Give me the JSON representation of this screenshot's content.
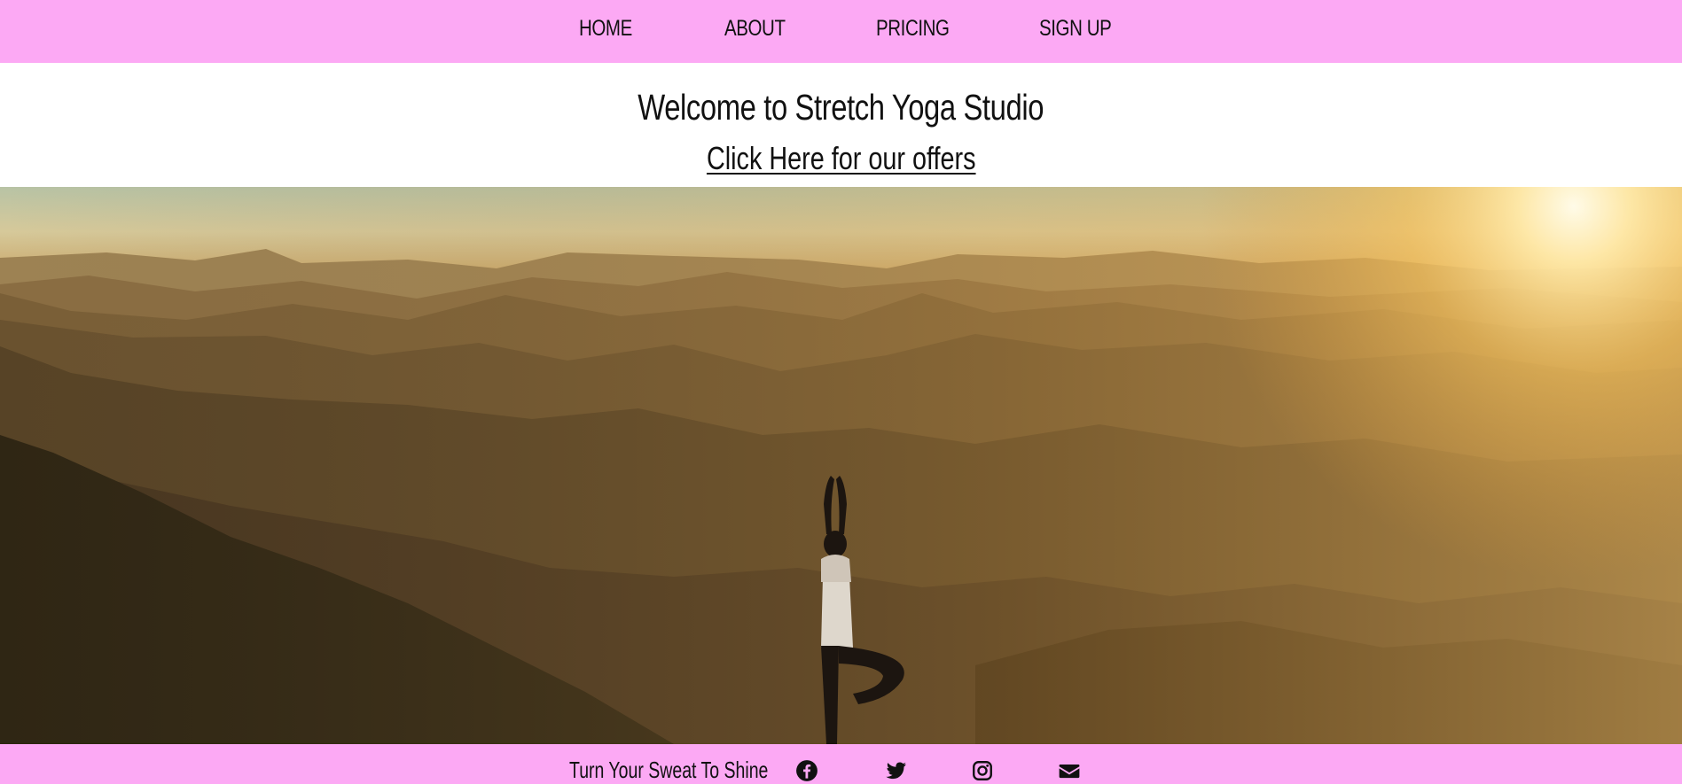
{
  "nav": {
    "items": [
      {
        "label": "HOME"
      },
      {
        "label": "ABOUT"
      },
      {
        "label": "PRICING"
      },
      {
        "label": "SIGN UP"
      }
    ]
  },
  "welcome": {
    "title": "Welcome to Stretch Yoga Studio",
    "offer_link": "Click Here for our offers"
  },
  "footer": {
    "tagline": "Turn Your Sweat To Shine",
    "social_icons": [
      "facebook-icon",
      "twitter-icon",
      "instagram-icon",
      "envelope-icon"
    ]
  },
  "colors": {
    "nav_background": "#fca9f4",
    "footer_background": "#fca9f4",
    "text": "#111111"
  }
}
